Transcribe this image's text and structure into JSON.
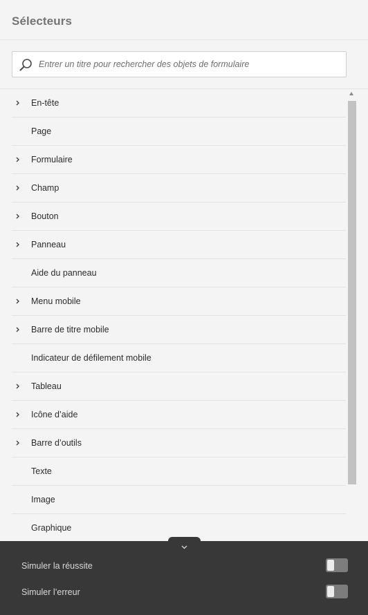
{
  "header": {
    "title": "Sélecteurs"
  },
  "search": {
    "placeholder": "Entrer un titre pour rechercher des objets de formulaire",
    "value": ""
  },
  "list": {
    "items": [
      {
        "label": "En-tête",
        "expandable": true
      },
      {
        "label": "Page",
        "expandable": false
      },
      {
        "label": "Formulaire",
        "expandable": true
      },
      {
        "label": "Champ",
        "expandable": true
      },
      {
        "label": "Bouton",
        "expandable": true
      },
      {
        "label": "Panneau",
        "expandable": true
      },
      {
        "label": "Aide du panneau",
        "expandable": false
      },
      {
        "label": "Menu mobile",
        "expandable": true
      },
      {
        "label": "Barre de titre mobile",
        "expandable": true
      },
      {
        "label": "Indicateur de défilement mobile",
        "expandable": false
      },
      {
        "label": "Tableau",
        "expandable": true
      },
      {
        "label": "Icône d’aide",
        "expandable": true
      },
      {
        "label": "Barre d’outils",
        "expandable": true
      },
      {
        "label": "Texte",
        "expandable": false
      },
      {
        "label": "Image",
        "expandable": false
      },
      {
        "label": "Graphique",
        "expandable": false
      }
    ]
  },
  "footer": {
    "toggles": [
      {
        "label": "Simuler la réussite",
        "on": false
      },
      {
        "label": "Simuler l’erreur",
        "on": false
      }
    ]
  },
  "colors": {
    "background": "#f4f4f4",
    "footer": "#383838",
    "scroll_thumb": "#c2c2c2"
  }
}
